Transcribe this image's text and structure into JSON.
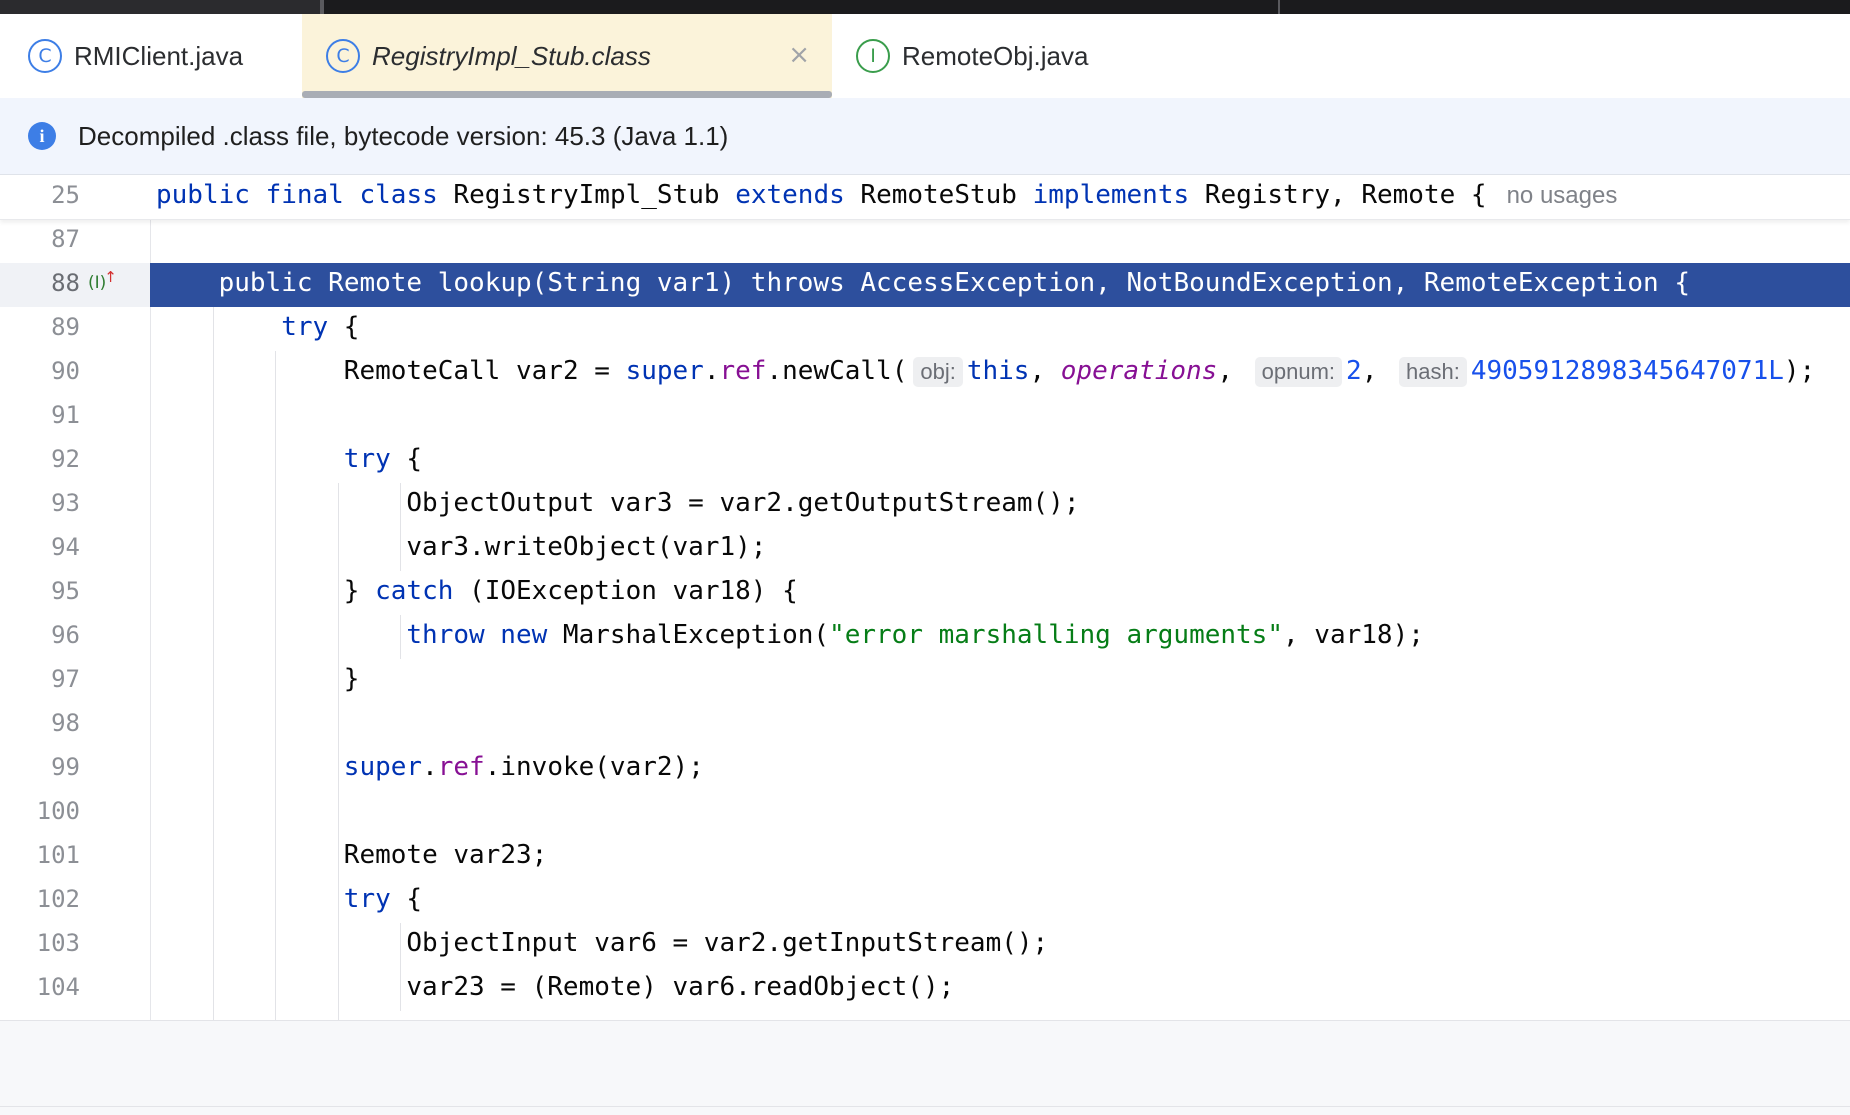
{
  "tabs": [
    {
      "label": "RMIClient.java",
      "icon": "class-runnable-icon",
      "active": false
    },
    {
      "label": "RegistryImpl_Stub.class",
      "icon": "class-compiled-icon",
      "active": true
    },
    {
      "label": "RemoteObj.java",
      "icon": "interface-icon",
      "active": false
    }
  ],
  "tab_icons": {
    "c": "C",
    "i": "I"
  },
  "close_glyph": "×",
  "banner": {
    "text": "Decompiled .class file, bytecode version: 45.3 (Java 1.1)",
    "icon": "info-icon"
  },
  "sticky": {
    "number": "25",
    "tokens": [
      {
        "t": "public final class",
        "k": "kw"
      },
      {
        "t": " RegistryImpl_Stub ",
        "k": ""
      },
      {
        "t": "extends",
        "k": "kw"
      },
      {
        "t": " RemoteStub ",
        "k": ""
      },
      {
        "t": "implements",
        "k": "kw"
      },
      {
        "t": " Registry, Remote {",
        "k": ""
      }
    ],
    "hint": "no usages"
  },
  "lines": [
    {
      "n": "87",
      "indent": 0,
      "tokens": []
    },
    {
      "n": "88",
      "indent": 1,
      "selected": true,
      "tokens": [
        {
          "t": "public Remote lookup(String var1) throws AccessException, NotBoundException, RemoteException {",
          "k": ""
        }
      ]
    },
    {
      "n": "89",
      "indent": 2,
      "tokens": [
        {
          "t": "try",
          "k": "kw"
        },
        {
          "t": " {",
          "k": ""
        }
      ]
    },
    {
      "n": "90",
      "indent": 3,
      "tokens": [
        {
          "t": "RemoteCall var2 = ",
          "k": ""
        },
        {
          "t": "super",
          "k": "kw"
        },
        {
          "t": ".",
          "k": ""
        },
        {
          "t": "ref",
          "k": "fld"
        },
        {
          "t": ".newCall(",
          "k": ""
        },
        {
          "t": "obj:",
          "k": "hint"
        },
        {
          "t": "this",
          "k": "kw"
        },
        {
          "t": ", ",
          "k": ""
        },
        {
          "t": "operations",
          "k": "ital"
        },
        {
          "t": ", ",
          "k": ""
        },
        {
          "t": "opnum:",
          "k": "hint"
        },
        {
          "t": "2",
          "k": "num"
        },
        {
          "t": ", ",
          "k": ""
        },
        {
          "t": "hash:",
          "k": "hint"
        },
        {
          "t": "4905912898345647071L",
          "k": "num"
        },
        {
          "t": ");",
          "k": ""
        }
      ]
    },
    {
      "n": "91",
      "indent": 3,
      "tokens": []
    },
    {
      "n": "92",
      "indent": 3,
      "tokens": [
        {
          "t": "try",
          "k": "kw"
        },
        {
          "t": " {",
          "k": ""
        }
      ]
    },
    {
      "n": "93",
      "indent": 4,
      "tokens": [
        {
          "t": "ObjectOutput var3 = var2.getOutputStream();",
          "k": ""
        }
      ]
    },
    {
      "n": "94",
      "indent": 4,
      "tokens": [
        {
          "t": "var3.writeObject(var1);",
          "k": ""
        }
      ]
    },
    {
      "n": "95",
      "indent": 3,
      "tokens": [
        {
          "t": "} ",
          "k": ""
        },
        {
          "t": "catch",
          "k": "kw"
        },
        {
          "t": " (IOException var18) {",
          "k": ""
        }
      ]
    },
    {
      "n": "96",
      "indent": 4,
      "tokens": [
        {
          "t": "throw new",
          "k": "kw"
        },
        {
          "t": " MarshalException(",
          "k": ""
        },
        {
          "t": "\"error marshalling arguments\"",
          "k": "str"
        },
        {
          "t": ", var18);",
          "k": ""
        }
      ]
    },
    {
      "n": "97",
      "indent": 3,
      "tokens": [
        {
          "t": "}",
          "k": ""
        }
      ]
    },
    {
      "n": "98",
      "indent": 3,
      "tokens": []
    },
    {
      "n": "99",
      "indent": 3,
      "tokens": [
        {
          "t": "super",
          "k": "kw"
        },
        {
          "t": ".",
          "k": ""
        },
        {
          "t": "ref",
          "k": "fld"
        },
        {
          "t": ".invoke(var2);",
          "k": ""
        }
      ]
    },
    {
      "n": "100",
      "indent": 3,
      "tokens": []
    },
    {
      "n": "101",
      "indent": 3,
      "tokens": [
        {
          "t": "Remote var23;",
          "k": ""
        }
      ]
    },
    {
      "n": "102",
      "indent": 3,
      "tokens": [
        {
          "t": "try",
          "k": "kw"
        },
        {
          "t": " {",
          "k": ""
        }
      ]
    },
    {
      "n": "103",
      "indent": 4,
      "tokens": [
        {
          "t": "ObjectInput var6 = var2.getInputStream();",
          "k": ""
        }
      ]
    },
    {
      "n": "104",
      "indent": 4,
      "tokens": [
        {
          "t": "var23 = (Remote) var6.readObject();",
          "k": ""
        }
      ]
    }
  ],
  "gutter_marker": {
    "icon": "implements-method-icon",
    "glyph": "I",
    "arrow": "↑"
  }
}
